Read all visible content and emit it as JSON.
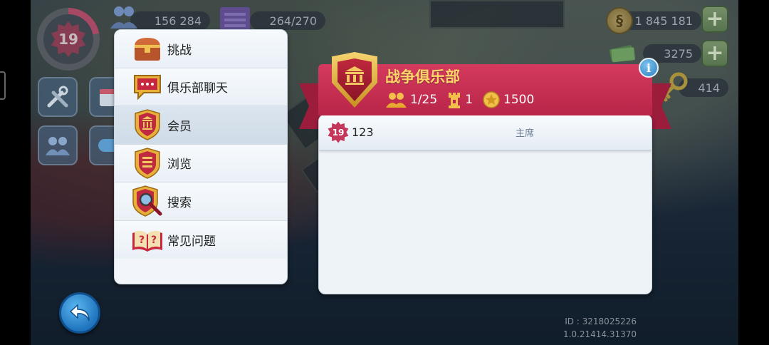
{
  "hud": {
    "level": "19",
    "population": "156 284",
    "storage": "264/270",
    "simoleons": "1 845 181",
    "simcash": "3275",
    "keys": "414"
  },
  "menu": {
    "items": [
      {
        "label": "挑战",
        "icon": "chest-icon"
      },
      {
        "label": "俱乐部聊天",
        "icon": "chat-icon"
      },
      {
        "label": "会员",
        "icon": "club-shield-icon",
        "active": true
      },
      {
        "label": "浏览",
        "icon": "browse-shield-icon"
      },
      {
        "label": "搜索",
        "icon": "search-icon"
      },
      {
        "label": "常见问题",
        "icon": "faq-book-icon"
      }
    ]
  },
  "club": {
    "name": "战争俱乐部",
    "members": "1/25",
    "wars": "1",
    "points": "1500",
    "info_label": "i",
    "rows": [
      {
        "level": "19",
        "name": "123",
        "role": "主席"
      }
    ]
  },
  "footer": {
    "id": "ID : 3218025226",
    "version": "1.0.21414.31370"
  },
  "colors": {
    "ribbon": "#c22f52",
    "title_gold": "#ffd46a",
    "panel": "#eef3f8",
    "back_button": "#2a86cc"
  }
}
